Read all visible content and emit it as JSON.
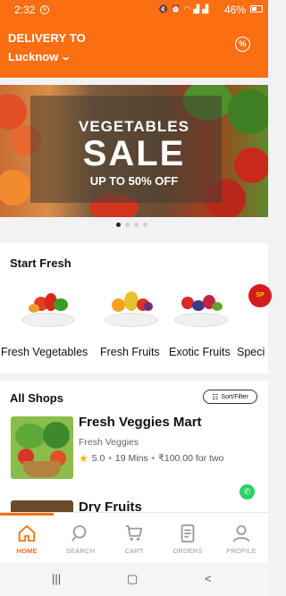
{
  "status_bar": {
    "time": "2:32",
    "battery": "46%"
  },
  "header": {
    "delivery_label": "DELIVERY TO",
    "city": "Lucknow"
  },
  "banner": {
    "line1": "VEGETABLES",
    "line2": "SALE",
    "line3": "UP TO 50% OFF",
    "dot_count": 4,
    "active_dot": 0
  },
  "start_fresh": {
    "title": "Start Fresh",
    "categories": [
      {
        "label": "Fresh Vegetables",
        "icon": "vegetables-icon"
      },
      {
        "label": "Fresh Fruits",
        "icon": "fruits-icon"
      },
      {
        "label": "Exotic Fruits",
        "icon": "berries-icon"
      },
      {
        "label": "Speci",
        "icon": "special-sale-icon"
      }
    ]
  },
  "all_shops": {
    "title": "All Shops",
    "sort_label": "Sort/Filter",
    "shops": [
      {
        "name": "Fresh Veggies Mart",
        "category": "Fresh Veggies",
        "rating": "5.0",
        "eta": "19 Mins",
        "price": "₹100.00 for two"
      },
      {
        "name": "Dry Fruits"
      }
    ]
  },
  "bottom_nav": {
    "items": [
      {
        "label": "HOME",
        "icon": "home-icon",
        "active": true
      },
      {
        "label": "SEARCH",
        "icon": "search-icon",
        "active": false
      },
      {
        "label": "CART",
        "icon": "cart-icon",
        "active": false
      },
      {
        "label": "ORDERS",
        "icon": "orders-icon",
        "active": false
      },
      {
        "label": "PROFILE",
        "icon": "profile-icon",
        "active": false
      }
    ]
  },
  "colors": {
    "brand": "#fb6f12",
    "rating_star": "#f5b301",
    "whatsapp": "#25d366"
  }
}
